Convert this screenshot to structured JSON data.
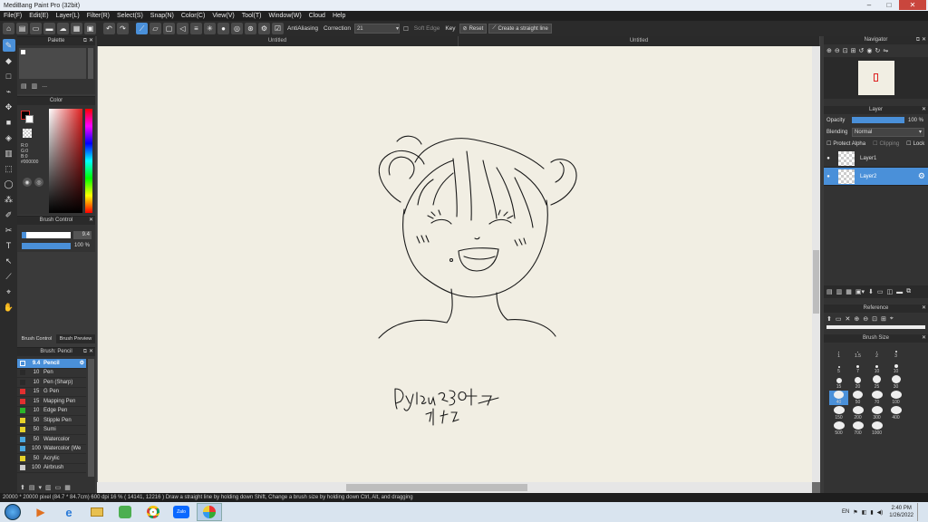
{
  "window": {
    "title": "MediBang Paint Pro (32bit)",
    "minimize": "–",
    "maximize": "□",
    "close": "✕"
  },
  "menu": [
    "File(F)",
    "Edit(E)",
    "Layer(L)",
    "Filter(R)",
    "Select(S)",
    "Snap(N)",
    "Color(C)",
    "View(V)",
    "Tool(T)",
    "Window(W)",
    "Cloud",
    "Help"
  ],
  "toolbar": {
    "antialiasing": "AntiAliasing",
    "correction_label": "Correction",
    "correction_value": "21",
    "soft_edge": "Soft Edge",
    "key": "Key",
    "reset": "Reset",
    "straight_line": "Create a straight line"
  },
  "palette": {
    "title": "Palette",
    "dots": "..."
  },
  "color": {
    "title": "Color",
    "r": "R:0",
    "g": "G:0",
    "b": "B:0",
    "hex": "#000000"
  },
  "brush_control": {
    "title": "Brush Control",
    "size_value": "9.4",
    "opacity_value": "100 %"
  },
  "left_tabs": {
    "brush_control": "Brush Control",
    "brush_preview": "Brush Preview"
  },
  "brush_list": {
    "title": "Brush: Pencil",
    "items": [
      {
        "size": "9.4",
        "name": "Pencil",
        "color": "#2a2a2a"
      },
      {
        "size": "10",
        "name": "Pen",
        "color": "#2a2a2a"
      },
      {
        "size": "10",
        "name": "Pen (Sharp)",
        "color": "#2a2a2a"
      },
      {
        "size": "15",
        "name": "G Pen",
        "color": "#e23030"
      },
      {
        "size": "15",
        "name": "Mapping Pen",
        "color": "#e23030"
      },
      {
        "size": "10",
        "name": "Edge Pen",
        "color": "#2ab52a"
      },
      {
        "size": "50",
        "name": "Stipple Pen",
        "color": "#e6d22a"
      },
      {
        "size": "50",
        "name": "Sumi",
        "color": "#e6d22a"
      },
      {
        "size": "50",
        "name": "Watercolor",
        "color": "#4aa8e0"
      },
      {
        "size": "100",
        "name": "Watercolor (We",
        "color": "#4aa8e0"
      },
      {
        "size": "50",
        "name": "Acrylic",
        "color": "#e6d22a"
      },
      {
        "size": "100",
        "name": "Airbrush",
        "color": "#cccccc"
      }
    ]
  },
  "tabs": [
    "Untitled",
    "Untitled"
  ],
  "navigator": {
    "title": "Navigator"
  },
  "layer": {
    "title": "Layer",
    "opacity_label": "Opacity",
    "opacity_value": "100 %",
    "opacity_fraction": 1.0,
    "blending_label": "Blending",
    "blending_value": "Normal",
    "protect_alpha": "Protect Alpha",
    "clipping": "Clipping",
    "lock": "Lock",
    "layers": [
      "Layer1",
      "Layer2"
    ]
  },
  "reference": {
    "title": "Reference"
  },
  "brush_size": {
    "title": "Brush Size",
    "sizes": [
      "1",
      "1.5",
      "2",
      "3",
      "5",
      "7",
      "10",
      "10",
      "15",
      "20",
      "25",
      "30",
      "40",
      "50",
      "70",
      "100",
      "150",
      "200",
      "300",
      "400",
      "500",
      "700",
      "1000"
    ]
  },
  "drawing": {
    "signature_line1": "Dylan 280일 7",
    "signature_line2": "+17 14"
  },
  "status": {
    "text": "20000 * 20000 pixel   (84.7 * 84.7cm)  600 dpi  16 %   ( 14141, 12216 )   Draw a straight line by holding down Shift, Change a brush size by holding down Ctrl, Alt, and dragging"
  },
  "taskbar": {
    "lang": "EN",
    "time": "2:40 PM",
    "date": "1/26/2022"
  }
}
